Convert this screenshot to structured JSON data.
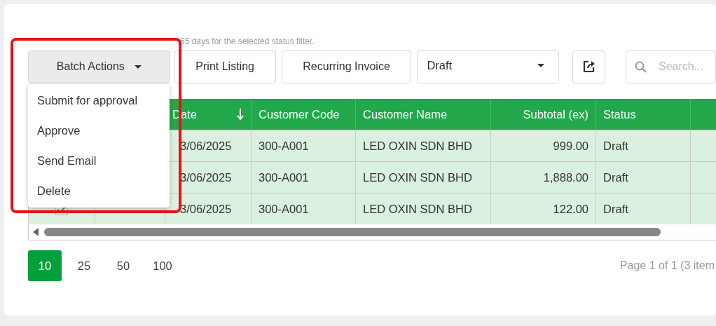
{
  "note": "65 days for the selected status filter.",
  "toolbar": {
    "batch_actions": {
      "label": "Batch Actions",
      "expanded": true
    },
    "buttons": [
      "Print Listing",
      "Recurring Invoice"
    ],
    "status_select": {
      "value": "Draft"
    },
    "search": {
      "placeholder": "Search..."
    }
  },
  "batch_menu": [
    "Submit for approval",
    "Approve",
    "Send Email",
    "Delete"
  ],
  "table": {
    "columns": [
      {
        "label": "Date",
        "sorted": true,
        "kind": "text"
      },
      {
        "label": "Customer Code",
        "kind": "text"
      },
      {
        "label": "Customer Name",
        "kind": "text"
      },
      {
        "label": "Subtotal (ex)",
        "kind": "number"
      },
      {
        "label": "Status",
        "kind": "text"
      }
    ],
    "rows": [
      {
        "cells": [
          "3/06/2025",
          "300-A001",
          "LED OXIN SDN BHD",
          "999.00",
          "Draft"
        ]
      },
      {
        "cells": [
          "3/06/2025",
          "300-A001",
          "LED OXIN SDN BHD",
          "1,888.00",
          "Draft"
        ]
      },
      {
        "checked": true,
        "cells": [
          "3/06/2025",
          "300-A001",
          "LED OXIN SDN BHD",
          "122.00",
          "Draft"
        ]
      }
    ]
  },
  "page_sizes": [
    {
      "label": "10",
      "selected": true
    },
    {
      "label": "25",
      "selected": false
    },
    {
      "label": "50",
      "selected": false
    },
    {
      "label": "100",
      "selected": false
    }
  ],
  "page_info": "Page 1 of 1 (3 item"
}
